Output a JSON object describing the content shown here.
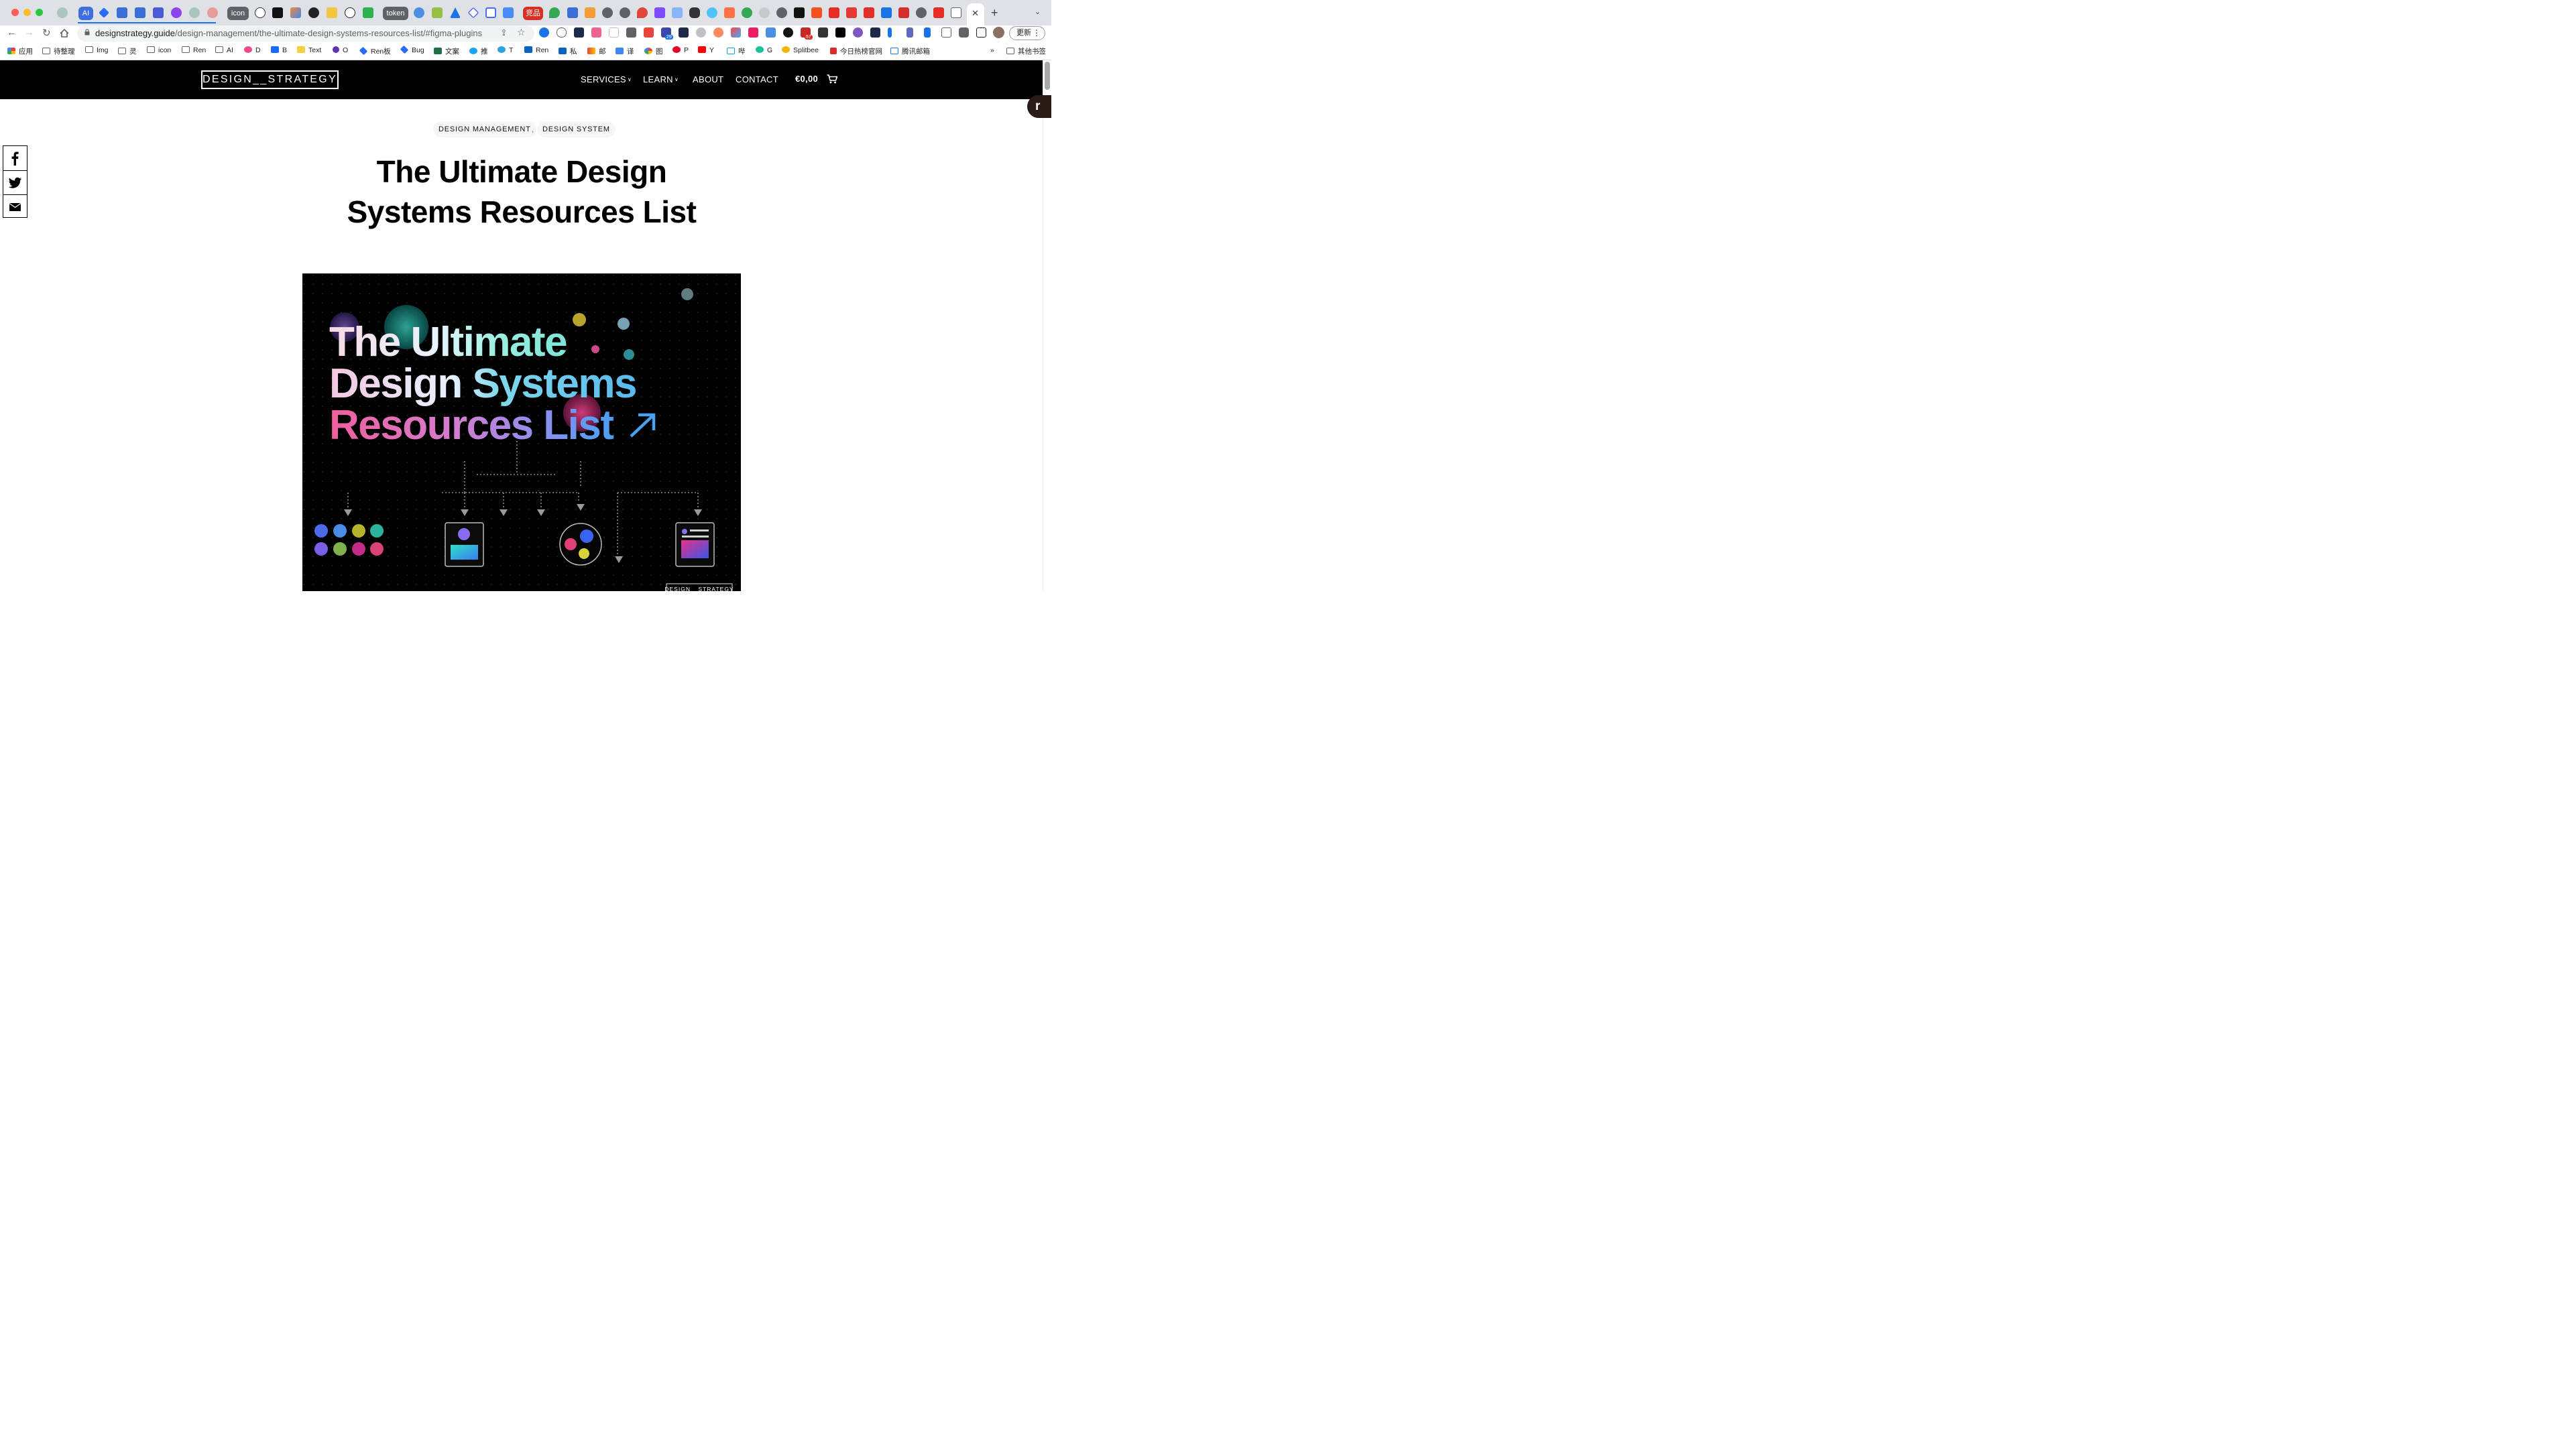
{
  "browser": {
    "tab_pills": [
      "AI",
      "icon",
      "token",
      "竞品"
    ],
    "url_host": "designstrategy.guide",
    "url_path": "/design-management/the-ultimate-design-systems-resources-list/#figma-plugins",
    "ext_badges": [
      "29",
      "57"
    ],
    "update_label": "更新",
    "update_dots": "⋮",
    "bookmarks": [
      "应用",
      "待整理",
      "Img",
      "灵",
      "icon",
      "Ren",
      "AI",
      "D",
      "B",
      "Text",
      "O",
      "Ren板",
      "Bug",
      "文案",
      "推",
      "T",
      "Ren",
      "私",
      "邮",
      "译",
      "图",
      "P",
      "Y",
      "哔",
      "G",
      "Splitbee",
      "今日热榜官网",
      "腾讯邮箱"
    ],
    "bookmarks_more": "»",
    "other_bookmarks": "其他书签"
  },
  "site": {
    "logo": "DESIGN__STRATEGY",
    "nav": [
      "SERVICES",
      "LEARN",
      "ABOUT",
      "CONTACT"
    ],
    "cart_total": "€0,00",
    "float_badge": "r"
  },
  "article": {
    "tags": [
      "DESIGN MANAGEMENT",
      "DESIGN SYSTEM"
    ],
    "tag_separator": ",",
    "title_line1": "The Ultimate Design",
    "title_line2": "Systems Resources List",
    "hero": {
      "line1": "The Ultimate",
      "line2a": "Design",
      "line2b": "Systems",
      "line3": "Resources List",
      "arrow": "↗",
      "watermark": "DESIGN__STRATEGY"
    }
  },
  "colors": {
    "header_bg": "#000000",
    "hero_bg": "#000000",
    "link_blue": "#1a73e8"
  }
}
